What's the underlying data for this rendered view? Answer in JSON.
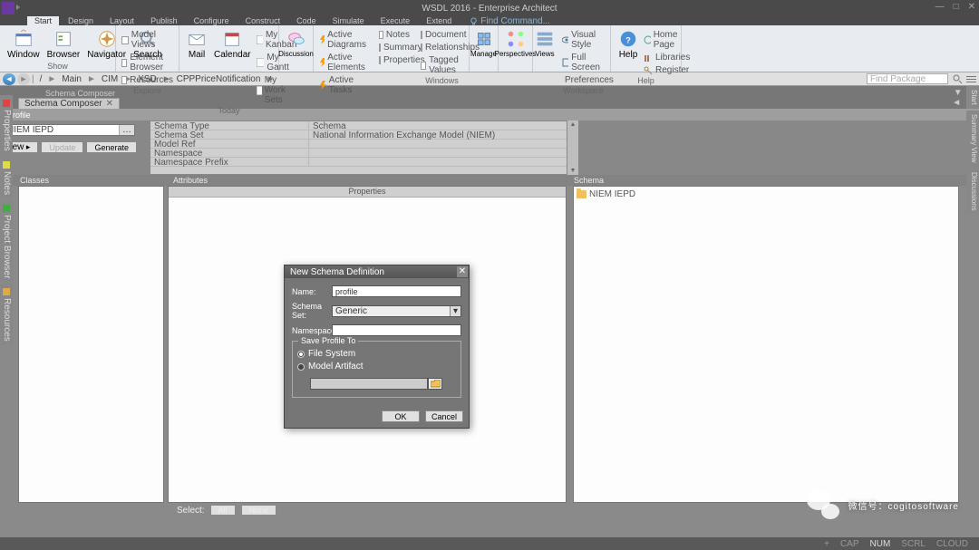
{
  "title": "WSDL 2016 - Enterprise Architect",
  "menus": [
    "Start",
    "Design",
    "Layout",
    "Publish",
    "Configure",
    "Construct",
    "Code",
    "Simulate",
    "Execute",
    "Extend"
  ],
  "find_cmd": "Find Command...",
  "ribbon": {
    "show": {
      "window": "Window",
      "browser": "Browser",
      "navigator": "Navigator",
      "search": "Search",
      "label": "Show"
    },
    "explore": {
      "items": [
        "Model Views",
        "Element Browser",
        "Resources"
      ],
      "label": "Explore"
    },
    "today": {
      "mail": "Mail",
      "calendar": "Calendar",
      "items": [
        "My Kanban",
        "My Gantt",
        "My Work Sets"
      ],
      "label": "Today"
    },
    "discussion": {
      "label": "Discussion"
    },
    "windows": {
      "items": [
        "Active Diagrams",
        "Active Elements",
        "Active Tasks"
      ],
      "label": "Windows"
    },
    "views": {
      "items": [
        "Notes",
        "Summary",
        "Properties"
      ],
      "label": ""
    },
    "views2": {
      "items": [
        "Document",
        "Relationships",
        "Tagged Values"
      ],
      "label": "Windows"
    },
    "manage": {
      "label": "Manage"
    },
    "perspectives": {
      "label": "Perspectives"
    },
    "views3": {
      "label": "Views"
    },
    "workspace": {
      "items": [
        "Visual Style",
        "Full Screen",
        "Preferences"
      ],
      "label": "Workspace"
    },
    "help": {
      "big": "Help",
      "items": [
        "Home Page",
        "Libraries",
        "Register"
      ],
      "label": "Help"
    }
  },
  "breadcrumbs": [
    "Main",
    "CIM",
    "XSD",
    "CPPPriceNotification"
  ],
  "find_pkg": "Find Package",
  "tab": {
    "title": "Schema Composer",
    "doc": "Schema Composer"
  },
  "profile": {
    "title": "Profile",
    "value": "NIEM IEPD",
    "new": "New",
    "update": "Update",
    "generate": "Generate"
  },
  "props": {
    "rows": [
      {
        "k": "Schema Type",
        "v": "Schema"
      },
      {
        "k": "Schema Set",
        "v": "National Information Exchange Model (NIEM)"
      },
      {
        "k": "Model Ref",
        "v": ""
      },
      {
        "k": "Namespace",
        "v": ""
      },
      {
        "k": "Namespace Prefix",
        "v": ""
      }
    ]
  },
  "sections": {
    "classes": "Classes",
    "attributes": "Attributes",
    "schema": "Schema",
    "properties": "Properties",
    "item": "NIEM IEPD"
  },
  "select": {
    "label": "Select:",
    "all": "All",
    "none": "None"
  },
  "dialog": {
    "title": "New Schema Definition",
    "name_lbl": "Name:",
    "name_val": "profile",
    "set_lbl": "Schema Set:",
    "set_val": "Generic",
    "ns_lbl": "Namespace:",
    "save": "Save Profile To",
    "fs": "File System",
    "ma": "Model Artifact",
    "ok": "OK",
    "cancel": "Cancel"
  },
  "side_left": [
    "Properties",
    "Notes",
    "Project Browser",
    "Resources"
  ],
  "side_right": [
    "Start",
    "Summary View",
    "Discussions"
  ],
  "status": {
    "cap": "CAP",
    "num": "NUM",
    "scrl": "SCRL",
    "cloud": "CLOUD"
  },
  "watermark": "微信号：cogitosoftware"
}
